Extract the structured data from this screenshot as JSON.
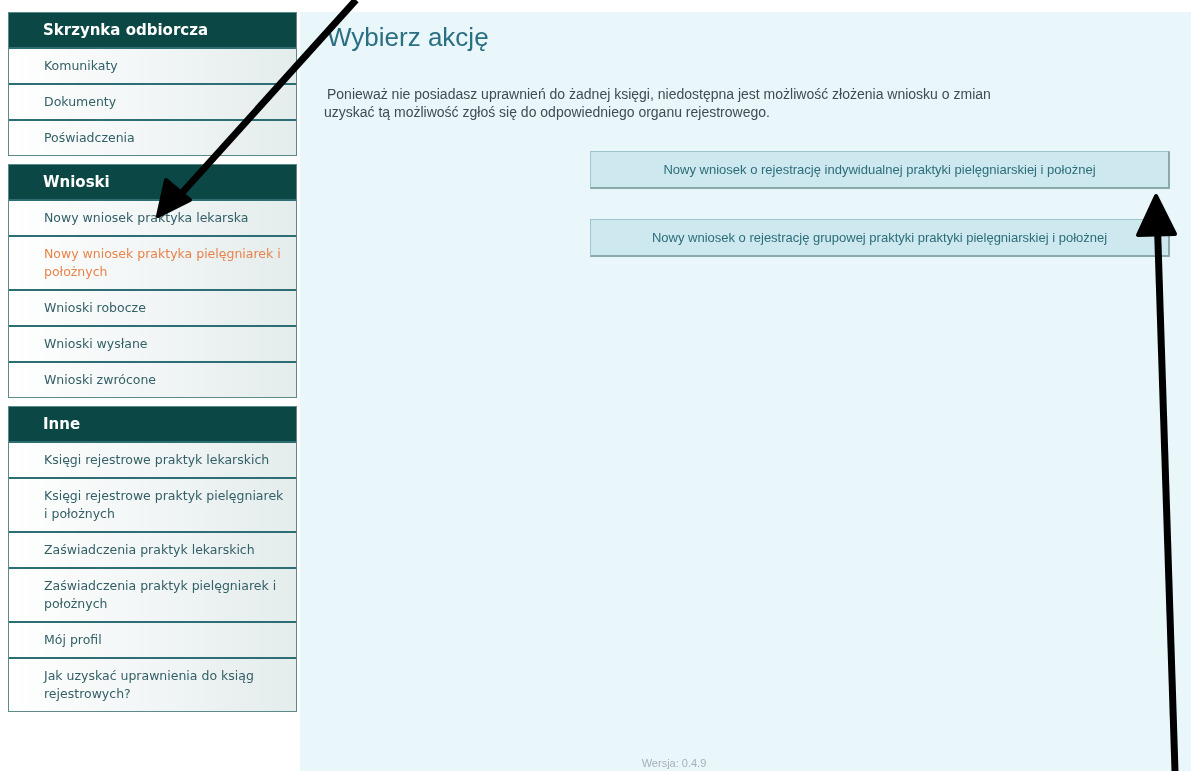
{
  "sidebar": {
    "sections": [
      {
        "title": "Skrzynka odbiorcza",
        "items": [
          {
            "label": "Komunikaty",
            "selected": false
          },
          {
            "label": "Dokumenty",
            "selected": false
          },
          {
            "label": "Poświadczenia",
            "selected": false
          }
        ]
      },
      {
        "title": "Wnioski",
        "items": [
          {
            "label": "Nowy wniosek praktyka lekarska",
            "selected": false
          },
          {
            "label": "Nowy wniosek praktyka pielęgniarek i położnych",
            "selected": true
          },
          {
            "label": "Wnioski robocze",
            "selected": false
          },
          {
            "label": "Wnioski wysłane",
            "selected": false
          },
          {
            "label": "Wnioski zwrócone",
            "selected": false
          }
        ]
      },
      {
        "title": "Inne",
        "items": [
          {
            "label": "Księgi rejestrowe praktyk lekarskich",
            "selected": false
          },
          {
            "label": "Księgi rejestrowe praktyk pielęgniarek i położnych",
            "selected": false
          },
          {
            "label": "Zaświadczenia praktyk lekarskich",
            "selected": false
          },
          {
            "label": "Zaświadczenia praktyk pielęgniarek i położnych",
            "selected": false
          },
          {
            "label": "Mój profil",
            "selected": false
          },
          {
            "label": "Jak uzyskać uprawnienia do ksiąg rejestrowych?",
            "selected": false
          }
        ]
      }
    ]
  },
  "main": {
    "title": "Wybierz akcję",
    "message": [
      "Ponieważ nie posiadasz uprawnień do żadnej księgi, niedostępna jest możliwość złożenia wniosku o zmian",
      "uzyskać tą możliwość zgłoś się do odpowiedniego organu rejestrowego."
    ],
    "buttons": [
      "Nowy wniosek o rejestrację indywidualnej praktyki pielęgniarskiej i położnej",
      "Nowy wniosek o rejestrację grupowej praktyki praktyki pielęgniarskiej i położnej"
    ],
    "version": "Wersja: 0.4.9"
  }
}
